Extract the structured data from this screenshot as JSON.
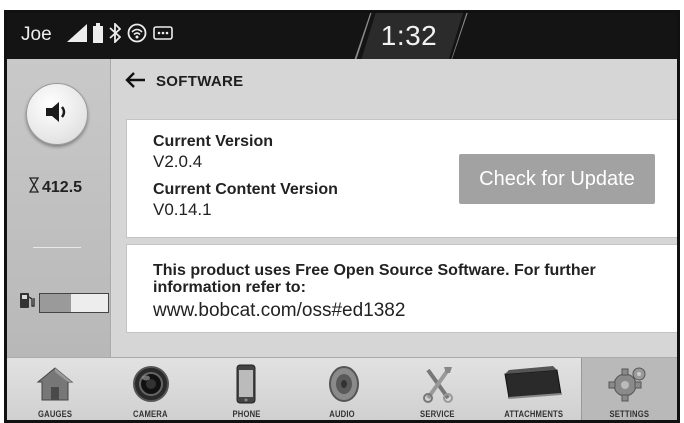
{
  "status_bar": {
    "user": "Joe",
    "time": "1:32",
    "icons": [
      "signal-icon",
      "battery-icon",
      "bluetooth-icon",
      "wifi-icon",
      "message-icon"
    ]
  },
  "left_panel": {
    "volume_icon": "speaker-icon",
    "hour_meter_value": "412.5",
    "fuel_level_percent": 45
  },
  "header": {
    "title": "SOFTWARE",
    "back_icon": "back-arrow-icon"
  },
  "version_card": {
    "current_version_label": "Current Version",
    "current_version_value": "V2.0.4",
    "content_version_label": "Current Content Version",
    "content_version_value": "V0.14.1",
    "check_button_label": "Check for Update"
  },
  "oss_card": {
    "notice": "This product uses Free Open Source Software. For further information refer to:",
    "url": "www.bobcat.com/oss#ed1382"
  },
  "bottom_nav": {
    "items": [
      {
        "label": "GAUGES",
        "icon": "house-icon"
      },
      {
        "label": "CAMERA",
        "icon": "camera-icon"
      },
      {
        "label": "PHONE",
        "icon": "phone-icon"
      },
      {
        "label": "AUDIO",
        "icon": "audio-icon"
      },
      {
        "label": "SERVICE",
        "icon": "wrench-icon"
      },
      {
        "label": "ATTACHMENTS",
        "icon": "bucket-icon"
      },
      {
        "label": "SETTINGS",
        "icon": "gear-icon"
      }
    ],
    "active": "SETTINGS"
  },
  "colors": {
    "status_bar_bg": "#141414",
    "button_bg": "#a2a2a2",
    "card_bg": "#ffffff",
    "panel_bg": "#d6d6d6"
  }
}
